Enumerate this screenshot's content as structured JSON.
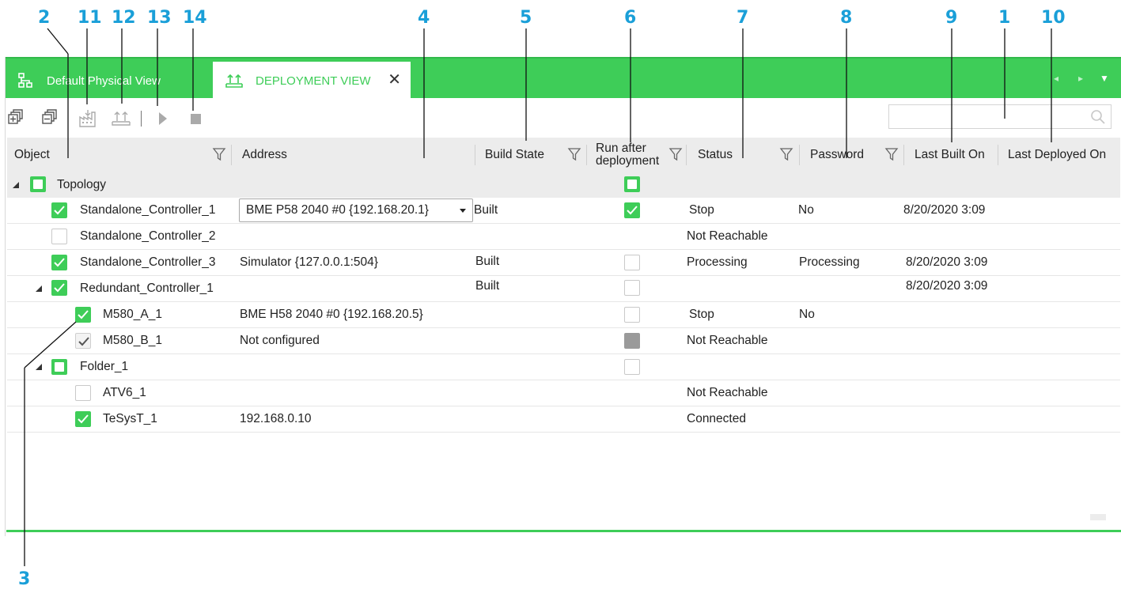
{
  "callouts": [
    "2",
    "11",
    "12",
    "13",
    "14",
    "4",
    "5",
    "6",
    "7",
    "8",
    "9",
    "1",
    "10",
    "3"
  ],
  "tabs": {
    "physical_label": "Default Physical View",
    "deployment_label": "DEPLOYMENT VIEW"
  },
  "icons": {
    "physical_tab": "network-tree-icon",
    "deployment_tab": "deploy-icon",
    "expand_all": "expand-all-icon",
    "collapse_all": "collapse-all-icon",
    "build": "build-icon",
    "deploy": "deploy-icon",
    "run": "play-icon",
    "stop": "stop-icon",
    "search": "search-icon",
    "filter": "filter-icon"
  },
  "search": {
    "placeholder": ""
  },
  "columns": {
    "object": "Object",
    "address": "Address",
    "build_state": "Build State",
    "run_after_line1": "Run after",
    "run_after_line2": "deployment",
    "status": "Status",
    "password": "Password",
    "last_built": "Last Built On",
    "last_deployed": "Last Deployed On"
  },
  "topology": {
    "label": "Topology"
  },
  "rows": [
    {
      "name": "Standalone_Controller_1",
      "address": "BME P58 2040 #0 {192.168.20.1}",
      "build": "Built",
      "status": "Stop",
      "password": "No",
      "built_on": "8/20/2020 3:09",
      "run": "checked"
    },
    {
      "name": "Standalone_Controller_2",
      "address": "",
      "build": "",
      "status": "Not Reachable",
      "password": "",
      "built_on": "",
      "run": ""
    },
    {
      "name": "Standalone_Controller_3",
      "address": "Simulator {127.0.0.1:504}",
      "build": "Built",
      "status": "Processing",
      "password": "Processing",
      "built_on": "8/20/2020 3:09",
      "run": "unchecked"
    },
    {
      "name": "Redundant_Controller_1",
      "address": "",
      "build": "Built",
      "status": "",
      "password": "",
      "built_on": "8/20/2020 3:09",
      "run": "unchecked"
    },
    {
      "name": "M580_A_1",
      "address": "BME H58 2040 #0 {192.168.20.5}",
      "build": "",
      "status": "Stop",
      "password": "No",
      "built_on": "",
      "run": "unchecked"
    },
    {
      "name": "M580_B_1",
      "address": "Not configured",
      "build": "",
      "status": "Not Reachable",
      "password": "",
      "built_on": "",
      "run": "disabled"
    },
    {
      "name": "Folder_1",
      "address": "",
      "build": "",
      "status": "",
      "password": "",
      "built_on": "",
      "run": "unchecked"
    },
    {
      "name": "ATV6_1",
      "address": "",
      "build": "",
      "status": "Not Reachable",
      "password": "",
      "built_on": "",
      "run": ""
    },
    {
      "name": "TeSysT_1",
      "address": "192.168.0.10",
      "build": "",
      "status": "Connected",
      "password": "",
      "built_on": "",
      "run": ""
    }
  ],
  "colors": {
    "accent_green": "#3ecd58",
    "callout_blue": "#1a9fd8",
    "header_grey": "#ececec",
    "disabled_grey": "#9a9a9a"
  }
}
